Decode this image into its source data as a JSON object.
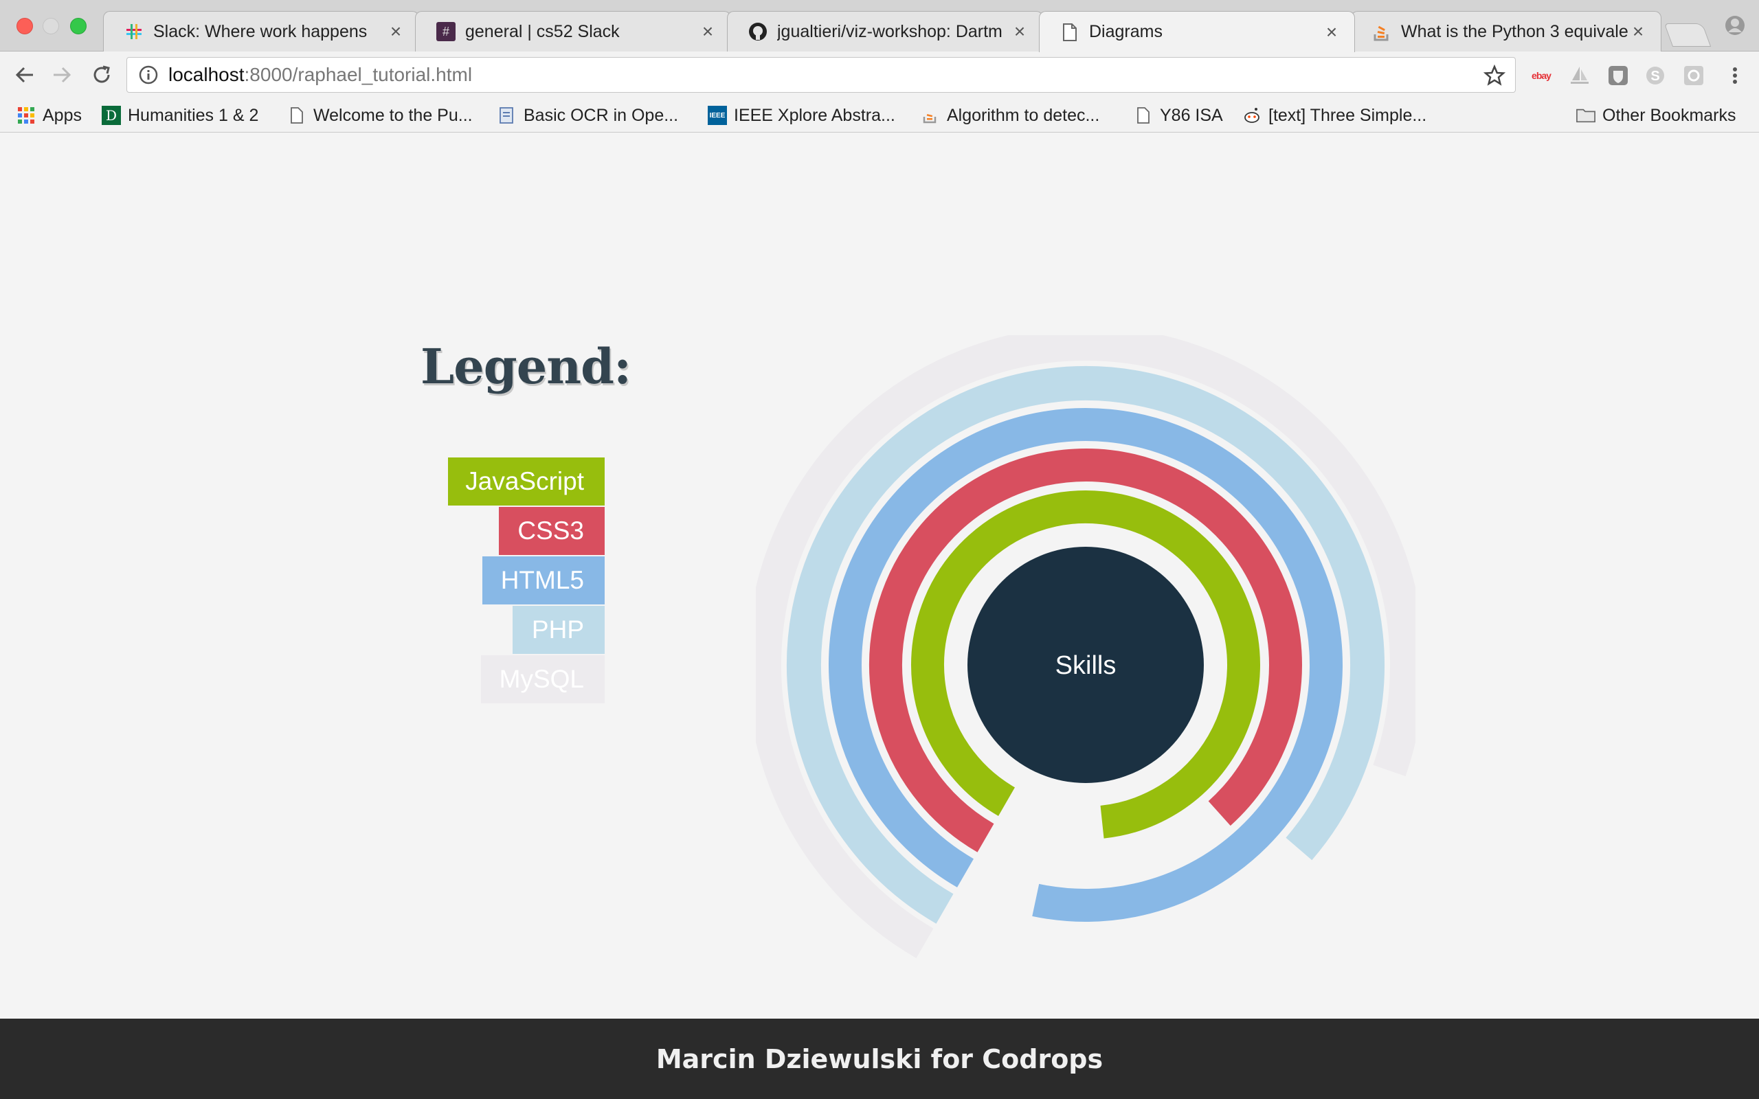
{
  "browser": {
    "tabs": [
      {
        "title": "Slack: Where work happens",
        "icon": "slack-icon"
      },
      {
        "title": "general | cs52 Slack",
        "icon": "hash-icon"
      },
      {
        "title": "jgualtieri/viz-workshop: Dartm",
        "icon": "github-icon"
      },
      {
        "title": "Diagrams",
        "icon": "page-icon"
      },
      {
        "title": "What is the Python 3 equivale",
        "icon": "stackoverflow-icon"
      }
    ],
    "address": {
      "host": "localhost",
      "path": ":8000/raphael_tutorial.html"
    },
    "bookmarks": [
      {
        "label": "Apps",
        "icon": "apps-grid-icon"
      },
      {
        "label": "Humanities 1 & 2",
        "icon": "dartmouth-icon"
      },
      {
        "label": "Welcome to the Pu...",
        "icon": "page-icon"
      },
      {
        "label": "Basic OCR in Ope...",
        "icon": "doc-icon"
      },
      {
        "label": "IEEE Xplore Abstra...",
        "icon": "ieee-icon"
      },
      {
        "label": "Algorithm to detec...",
        "icon": "stackoverflow-icon"
      },
      {
        "label": "Y86 ISA",
        "icon": "page-icon"
      },
      {
        "label": "[text] Three Simple...",
        "icon": "reddit-icon"
      }
    ],
    "other_bookmarks": "Other Bookmarks",
    "ebay_label": "ebay"
  },
  "page": {
    "legend_title": "Legend:",
    "legend": [
      {
        "label": "JavaScript",
        "color": "#97be0d"
      },
      {
        "label": "CSS3",
        "color": "#d84f5f"
      },
      {
        "label": "HTML5",
        "color": "#88b8e6"
      },
      {
        "label": "PHP",
        "color": "#bedbe9"
      },
      {
        "label": "MySQL",
        "color": "#edebee"
      }
    ],
    "center_label": "Skills",
    "footer": "Marcin Dziewulski for Codrops"
  },
  "chart_data": {
    "type": "radial-arc",
    "center_label": "Skills",
    "series": [
      {
        "name": "JavaScript",
        "percent": 90,
        "color": "#97be0d"
      },
      {
        "name": "CSS3",
        "percent": 80,
        "color": "#d84f5f"
      },
      {
        "name": "HTML5",
        "percent": 95,
        "color": "#88b8e6"
      },
      {
        "name": "PHP",
        "percent": 78,
        "color": "#bedbe9"
      },
      {
        "name": "MySQL",
        "percent": 72,
        "color": "#edebee"
      }
    ]
  }
}
